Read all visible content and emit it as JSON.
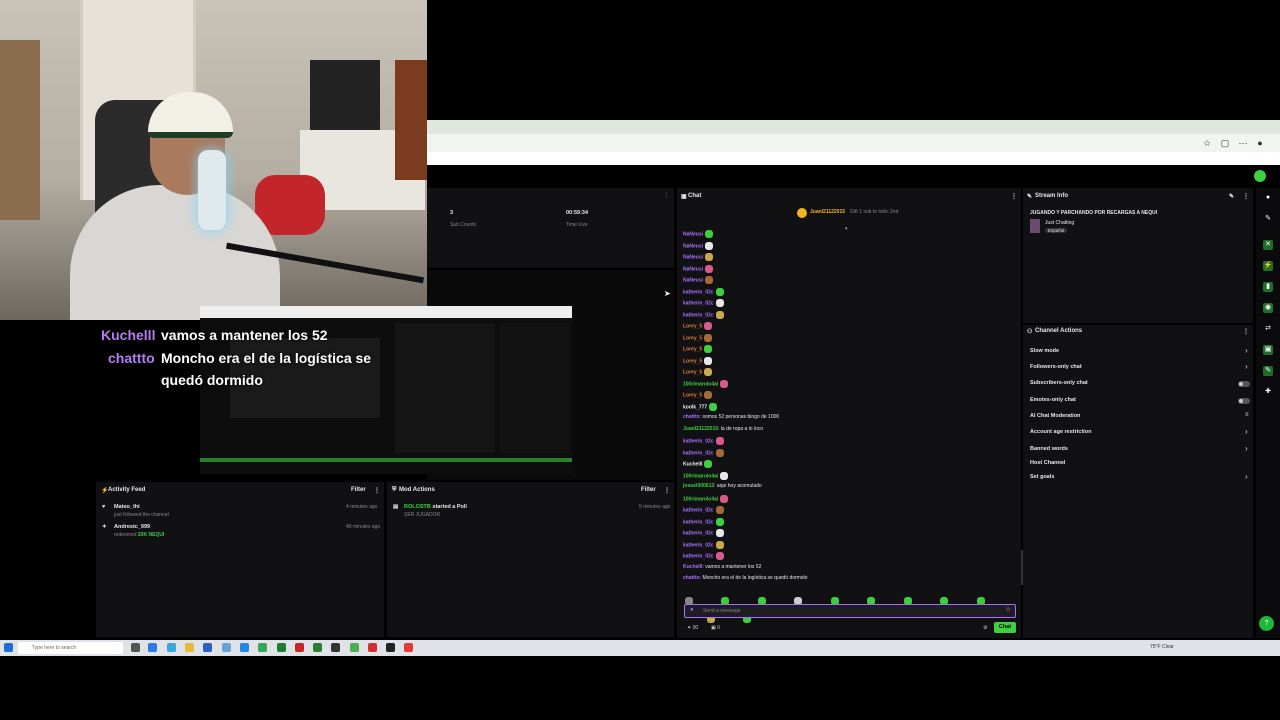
{
  "overlay": {
    "captions": [
      {
        "user": "Kuchelll",
        "text": "vamos a mantener los 52"
      },
      {
        "user": "chattto",
        "text_line1": "Moncho era el de la logística se",
        "text_line2": "quedó dormido"
      }
    ]
  },
  "stats": {
    "sub_count_value": "3",
    "sub_count_label": "Sub Counts",
    "time_value": "00:59:34",
    "time_label": "Time Live"
  },
  "activity_feed": {
    "title": "Activity Feed",
    "filter_label": "Filter",
    "items": [
      {
        "name": "Mateo_thi",
        "desc": "just followed the channel",
        "time": "4 minutes ago"
      },
      {
        "name": "Andrestc_999",
        "desc_prefix": "redeemed",
        "desc_highlight": "20K NEQUI",
        "time": "40 minutes ago"
      }
    ]
  },
  "mod_actions": {
    "title": "Mod Actions",
    "filter_label": "Filter",
    "items": [
      {
        "name": "ROLOSTB",
        "action": "started a Poll",
        "sub": "SER JUGADOR",
        "time": "5 minutes ago"
      }
    ]
  },
  "chat": {
    "title": "Chat",
    "pinned_user": "JuanI21122015",
    "pinned_text": "Gift 1 sub to tokic 2nd",
    "messages": [
      {
        "user": "NaNeusi",
        "color": "u-purple",
        "text": ""
      },
      {
        "user": "NaNeusi",
        "color": "u-purple",
        "text": ""
      },
      {
        "user": "NaNeusi",
        "color": "u-purple",
        "text": ""
      },
      {
        "user": "NaNeusi",
        "color": "u-purple",
        "text": ""
      },
      {
        "user": "NaNeusi",
        "color": "u-purple",
        "text": ""
      },
      {
        "user": "katherin_02c",
        "color": "u-purple",
        "text": ""
      },
      {
        "user": "katherin_02c",
        "color": "u-purple",
        "text": ""
      },
      {
        "user": "katherin_02c",
        "color": "u-purple",
        "text": ""
      },
      {
        "user": "Lorey_5",
        "color": "u-orange",
        "text": ""
      },
      {
        "user": "Lorey_5",
        "color": "u-orange",
        "text": ""
      },
      {
        "user": "Lorey_5",
        "color": "u-orange",
        "text": ""
      },
      {
        "user": "Lorey_5",
        "color": "u-orange",
        "text": ""
      },
      {
        "user": "Lorey_5",
        "color": "u-orange",
        "text": ""
      },
      {
        "user": "100rimarolo4ai",
        "color": "u-green",
        "text": ""
      },
      {
        "user": "Lorey_5",
        "color": "u-orange",
        "text": ""
      },
      {
        "user": "koolk_777",
        "color": "u-white",
        "text": ""
      },
      {
        "user": "chattto",
        "color": "u-purple",
        "text": "somos 52 personas bingo de 1000"
      },
      {
        "user": "JuanI21122015",
        "color": "u-green",
        "text": "la de ropa a lo loco"
      },
      {
        "user": "katherin_02c",
        "color": "u-purple",
        "text": ""
      },
      {
        "user": "katherin_02c",
        "color": "u-purple",
        "text": ""
      },
      {
        "user": "Kuchelll",
        "color": "u-white",
        "text": ""
      },
      {
        "user": "100rimarolo4ai",
        "color": "u-green",
        "text": ""
      },
      {
        "user": "josuel000612",
        "color": "u-green",
        "text": "aqui hoy acomulado"
      },
      {
        "user": "100rimarolo4ai",
        "color": "u-green",
        "text": ""
      },
      {
        "user": "katherin_02c",
        "color": "u-purple",
        "text": ""
      },
      {
        "user": "katherin_02c",
        "color": "u-purple",
        "text": ""
      },
      {
        "user": "katherin_02c",
        "color": "u-purple",
        "text": ""
      },
      {
        "user": "katherin_02c",
        "color": "u-purple",
        "text": ""
      },
      {
        "user": "katherin_02c",
        "color": "u-purple",
        "text": ""
      },
      {
        "user": "Kuchelll",
        "color": "u-purple",
        "text": "vamos a mantener los 52"
      },
      {
        "user": "chattto",
        "color": "u-purple",
        "text": "Moncho era el de la logística se quedó dormido"
      }
    ],
    "input_placeholder": "Send a message",
    "points": "00",
    "bits": "0",
    "chat_button": "Chat"
  },
  "stream_info": {
    "title": "Stream Info",
    "stream_title": "JUGANDO Y PARCHANDO POR RECARGAS A NEQUI",
    "category": "Just Chatting",
    "tag": "Español"
  },
  "channel_actions": {
    "title": "Channel Actions",
    "items": [
      {
        "label": "Slow mode",
        "control": "chevron"
      },
      {
        "label": "Followers-only chat",
        "control": "chevron"
      },
      {
        "label": "Subscribers-only chat",
        "control": "toggle"
      },
      {
        "label": "Emotes-only chat",
        "control": "toggle"
      },
      {
        "label": "AI Chat Moderation",
        "control": "icon"
      },
      {
        "label": "Account age restriction",
        "control": "chevron"
      },
      {
        "label": "Banned words",
        "control": "chevron"
      },
      {
        "label": "Host Channel",
        "control": "none"
      },
      {
        "label": "Set goals",
        "control": "chevron"
      }
    ]
  },
  "taskbar": {
    "search_placeholder": "Type here to search",
    "temperature": "75°F  Clear"
  },
  "colors": {
    "accent_green": "#3ecf3e",
    "twitch_purple": "#a970ff",
    "panel_bg": "#111114"
  }
}
